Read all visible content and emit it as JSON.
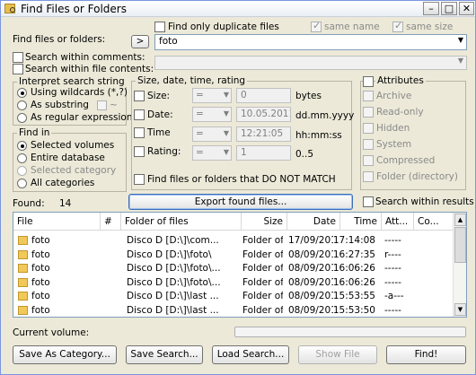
{
  "window": {
    "title": "Find Files or Folders"
  },
  "search": {
    "label": "Find files or folders:",
    "value": "foto",
    "arrow_label": ">",
    "dup_label": "Find only duplicate files",
    "same_name": "same name",
    "same_size": "same size",
    "within_comments": "Search within comments:",
    "within_contents": "Search within file contents:"
  },
  "interpret": {
    "title": "Interpret search string",
    "wildcards": "Using wildcards (*,?)",
    "substring": "As substring",
    "tilde": "~",
    "regex": "As regular expression"
  },
  "findin": {
    "title": "Find in",
    "selected": "Selected volumes",
    "database": "Entire database",
    "category": "Selected category",
    "all": "All categories"
  },
  "filters": {
    "title": "Size, date, time, rating",
    "size": {
      "label": "Size:",
      "op": "=",
      "value": "0",
      "unit": "bytes"
    },
    "date": {
      "label": "Date:",
      "op": "=",
      "value": "10.05.2011",
      "unit": "dd.mm.yyyy"
    },
    "time": {
      "label": "Time",
      "op": "=",
      "value": "12:21:05",
      "unit": "hh:mm:ss"
    },
    "rating": {
      "label": "Rating:",
      "op": "=",
      "value": "1",
      "unit": "0..5"
    },
    "not_match": "Find files or folders that DO NOT MATCH"
  },
  "attributes": {
    "title": "Attributes",
    "items": [
      "Archive",
      "Read-only",
      "Hidden",
      "System",
      "Compressed",
      "Folder (directory)"
    ]
  },
  "results": {
    "found_label": "Found:",
    "found_count": "14",
    "export_label": "Export found files...",
    "within_results": "Search within results",
    "columns": [
      "File",
      "#",
      "Folder of files",
      "Size",
      "Date",
      "Time",
      "Att...",
      "Co..."
    ],
    "rows": [
      {
        "file": "foto",
        "folder": "Disco D [D:\\]\\com...",
        "size": "Folder of ...",
        "date": "17/09/2010",
        "time": "17:14:08",
        "att": "-----"
      },
      {
        "file": "foto",
        "folder": "Disco D [D:\\]\\foto\\",
        "size": "Folder of ...",
        "date": "08/09/2010",
        "time": "16:27:35",
        "att": "r----"
      },
      {
        "file": "foto",
        "folder": "Disco D [D:\\]\\foto\\...",
        "size": "Folder of ...",
        "date": "08/09/2010",
        "time": "16:06:26",
        "att": "-----"
      },
      {
        "file": "foto",
        "folder": "Disco D [D:\\]\\foto\\...",
        "size": "Folder of ...",
        "date": "08/09/2010",
        "time": "16:06:26",
        "att": "-----"
      },
      {
        "file": "foto",
        "folder": "Disco D [D:\\]\\last ...",
        "size": "Folder of ...",
        "date": "08/09/2010",
        "time": "15:53:55",
        "att": "-a---"
      },
      {
        "file": "foto",
        "folder": "Disco D [D:\\]\\last ...",
        "size": "Folder of ...",
        "date": "08/09/2010",
        "time": "15:53:50",
        "att": "-----"
      }
    ]
  },
  "footer": {
    "current_volume": "Current volume:",
    "save_category": "Save As Category...",
    "save_search": "Save Search...",
    "load_search": "Load Search...",
    "show_file": "Show File",
    "find": "Find!"
  }
}
